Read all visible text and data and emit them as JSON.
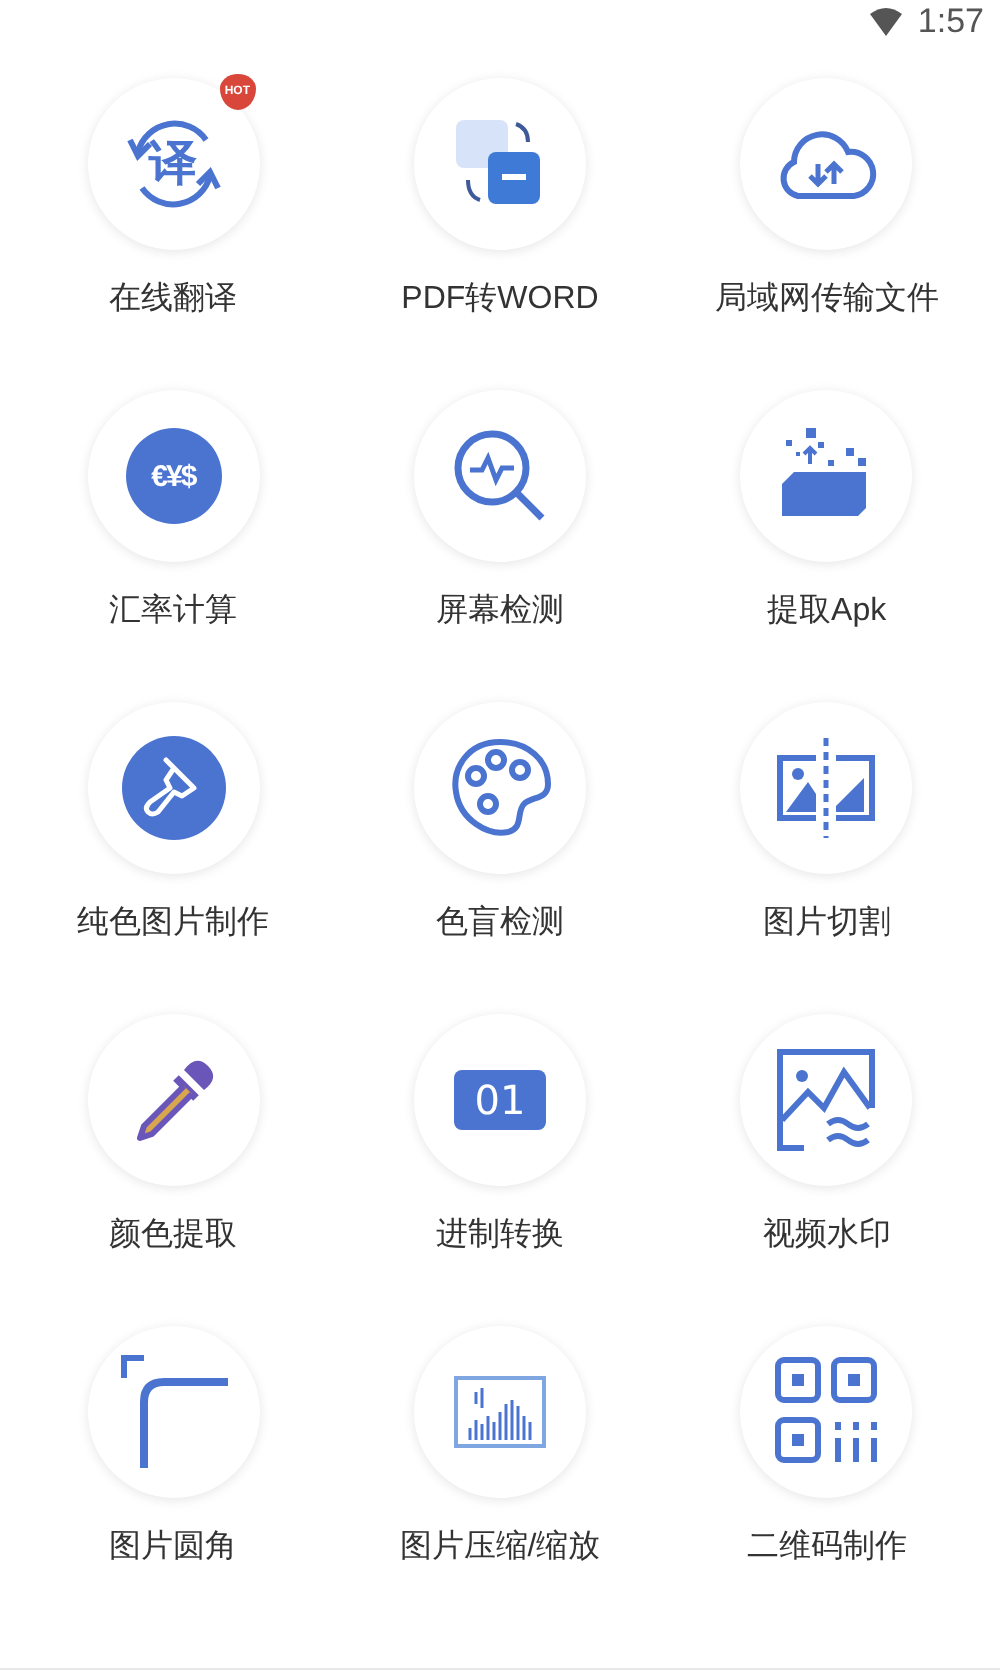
{
  "status_bar": {
    "time": "1:57"
  },
  "tools": [
    {
      "label": "在线翻译",
      "glyph": "译",
      "badge": "HOT"
    },
    {
      "label": "PDF转WORD"
    },
    {
      "label": "局域网传输文件"
    },
    {
      "label": "汇率计算",
      "glyph": "€¥$"
    },
    {
      "label": "屏幕检测"
    },
    {
      "label": "提取Apk"
    },
    {
      "label": "纯色图片制作"
    },
    {
      "label": "色盲检测"
    },
    {
      "label": "图片切割"
    },
    {
      "label": "颜色提取"
    },
    {
      "label": "进制转换",
      "glyph": "01"
    },
    {
      "label": "视频水印"
    },
    {
      "label": "图片圆角"
    },
    {
      "label": "图片压缩/缩放"
    },
    {
      "label": "二维码制作"
    }
  ]
}
